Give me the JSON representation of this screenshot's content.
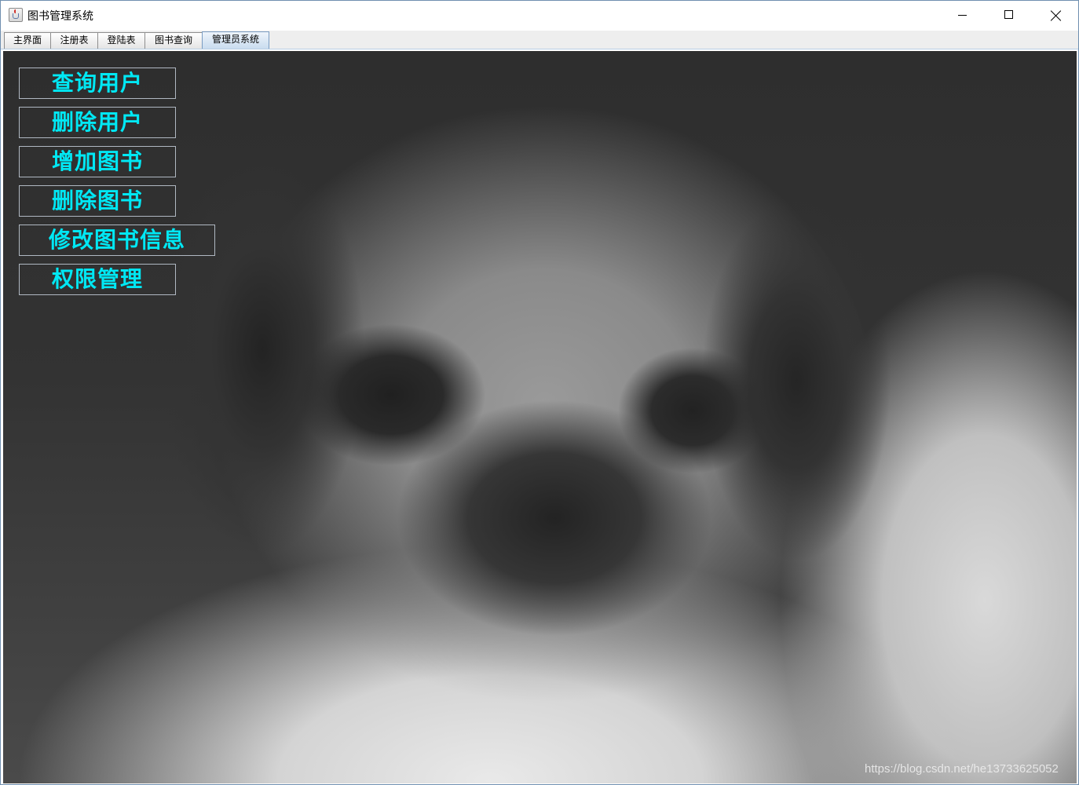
{
  "window": {
    "title": "图书管理系统"
  },
  "tabs": [
    {
      "label": "主界面",
      "active": false
    },
    {
      "label": "注册表",
      "active": false
    },
    {
      "label": "登陆表",
      "active": false
    },
    {
      "label": "图书查询",
      "active": false
    },
    {
      "label": "管理员系统",
      "active": true
    }
  ],
  "admin_menu": {
    "query_user": "查询用户",
    "delete_user": "删除用户",
    "add_book": "增加图书",
    "delete_book": "删除图书",
    "edit_book_info": "修改图书信息",
    "permission_manage": "权限管理"
  },
  "background": {
    "watermark": "https://blog.csdn.net/he13733625052"
  },
  "colors": {
    "button_text": "#00e8f4",
    "button_border": "#b0b8c2"
  },
  "icons": {
    "app": "java-cup-icon",
    "minimize": "minimize-icon",
    "maximize": "maximize-icon",
    "close": "close-icon"
  }
}
